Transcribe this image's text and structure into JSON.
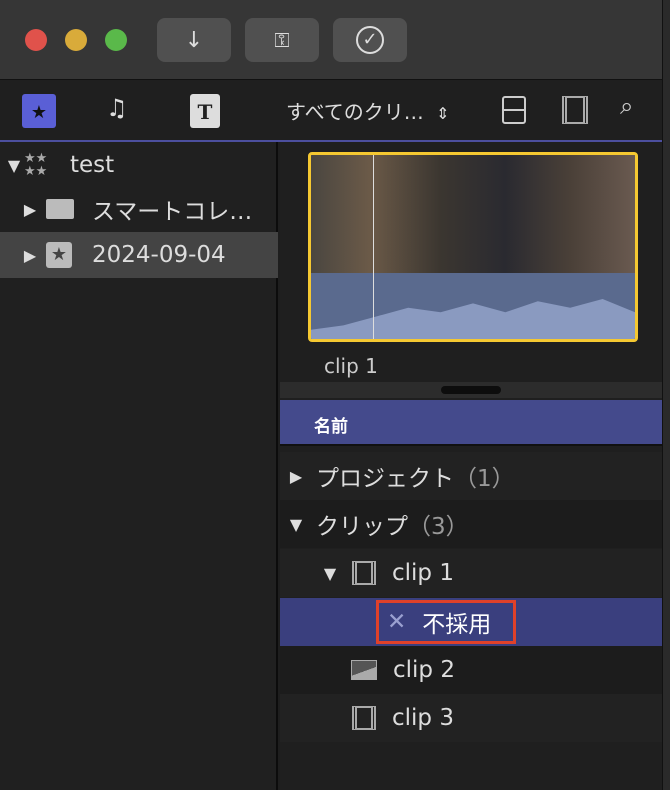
{
  "toolbar": {
    "filter_label": "すべてのクリ…"
  },
  "sidebar": {
    "items": [
      {
        "label": "test"
      },
      {
        "label": "スマートコレ…"
      },
      {
        "label": "2024-09-04"
      }
    ]
  },
  "viewer": {
    "clip_label": "clip 1"
  },
  "list": {
    "header": "名前",
    "rows": [
      {
        "label": "プロジェクト",
        "count": "（1）"
      },
      {
        "label": "クリップ",
        "count": "（3）"
      },
      {
        "label": "clip 1"
      },
      {
        "label": "不採用"
      },
      {
        "label": "clip 2"
      },
      {
        "label": "clip 3"
      }
    ]
  },
  "colors": {
    "accent": "#4c4f9e",
    "selection": "#3a3f7e",
    "highlight_box": "#e0412a",
    "clip_border": "#f5c831"
  }
}
